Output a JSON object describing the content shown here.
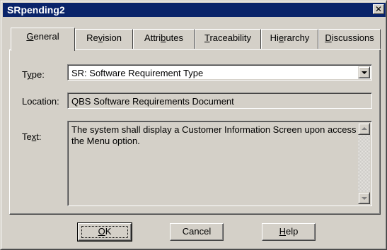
{
  "window": {
    "title": "SRpending2"
  },
  "tabs": [
    {
      "pre": "",
      "ul": "G",
      "post": "eneral",
      "active": true
    },
    {
      "pre": "Re",
      "ul": "v",
      "post": "ision"
    },
    {
      "pre": "Attri",
      "ul": "b",
      "post": "utes"
    },
    {
      "pre": "",
      "ul": "T",
      "post": "raceability"
    },
    {
      "pre": "Hi",
      "ul": "e",
      "post": "rarchy"
    },
    {
      "pre": "",
      "ul": "D",
      "post": "iscussions"
    }
  ],
  "form": {
    "type_label": {
      "pre": "T",
      "ul": "y",
      "post": "pe:"
    },
    "type_value": "SR: Software Requirement Type",
    "location_label": "Location:",
    "location_value": "QBS Software Requirements Document",
    "text_label": {
      "pre": "Te",
      "ul": "x",
      "post": "t:"
    },
    "text_value": "The system shall display a Customer Information Screen upon access of the Menu option."
  },
  "buttons": {
    "ok": {
      "pre": "",
      "ul": "O",
      "post": "K"
    },
    "cancel": "Cancel",
    "help": {
      "pre": "",
      "ul": "H",
      "post": "elp"
    }
  },
  "icons": {
    "close": "close-icon",
    "dropdown": "chevron-down-icon",
    "scroll_up": "scroll-up-icon",
    "scroll_down": "scroll-down-icon"
  },
  "colors": {
    "titlebar": "#0a246a",
    "face": "#d4d0c8"
  }
}
